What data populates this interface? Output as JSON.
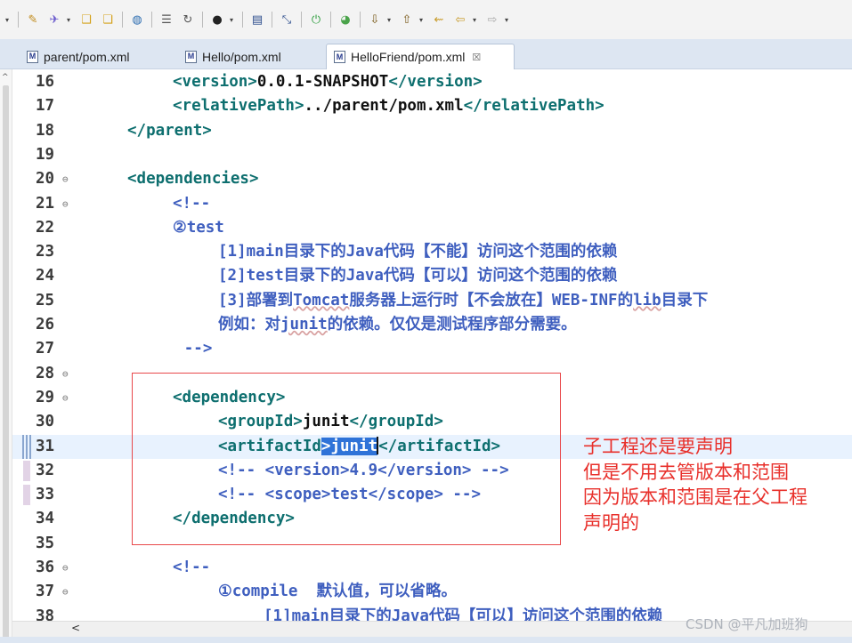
{
  "toolbar": {
    "icons": [
      "wizard-icon",
      "run-icon",
      "folder-icon",
      "folder-open-icon",
      "globe-icon",
      "build-icon",
      "refresh-icon",
      "debug-icon",
      "console-icon",
      "breakpoint-icon",
      "stop-icon",
      "server-icon",
      "down-arrow-icon",
      "up-arrow-icon",
      "back-icon",
      "forward-icon"
    ]
  },
  "tabs": [
    {
      "label": "parent/pom.xml",
      "active": false
    },
    {
      "label": "Hello/pom.xml",
      "active": false
    },
    {
      "label": "HelloFriend/pom.xml",
      "active": true,
      "close": "☒"
    }
  ],
  "editor": {
    "lines": [
      {
        "num": "16",
        "fold": "",
        "indent": "        ",
        "segments": [
          {
            "t": "t",
            "x": "<version>"
          },
          {
            "t": "v",
            "x": "0.0.1-SNAPSHOT"
          },
          {
            "t": "t",
            "x": "</version>"
          }
        ]
      },
      {
        "num": "17",
        "fold": "",
        "indent": "        ",
        "segments": [
          {
            "t": "t",
            "x": "<relativePath>"
          },
          {
            "t": "v",
            "x": "../parent/pom.xml"
          },
          {
            "t": "t",
            "x": "</relativePath>"
          }
        ]
      },
      {
        "num": "18",
        "fold": "",
        "indent": "    ",
        "segments": [
          {
            "t": "t",
            "x": "</parent>"
          }
        ]
      },
      {
        "num": "19",
        "fold": "",
        "indent": "",
        "segments": []
      },
      {
        "num": "20",
        "fold": "⊖",
        "indent": "    ",
        "segments": [
          {
            "t": "t",
            "x": "<dependencies>"
          }
        ]
      },
      {
        "num": "21",
        "fold": "⊖",
        "indent": "        ",
        "segments": [
          {
            "t": "c",
            "x": "<!--"
          }
        ]
      },
      {
        "num": "22",
        "fold": "",
        "indent": "        ",
        "segments": [
          {
            "t": "c",
            "x": "②test"
          }
        ]
      },
      {
        "num": "23",
        "fold": "",
        "indent": "            ",
        "segments": [
          {
            "t": "c",
            "x": "[1]main目录下的Java代码【不能】访问这个范围的依赖"
          }
        ]
      },
      {
        "num": "24",
        "fold": "",
        "indent": "            ",
        "segments": [
          {
            "t": "c",
            "x": "[2]test目录下的Java代码【可以】访问这个范围的依赖"
          }
        ]
      },
      {
        "num": "25",
        "fold": "",
        "indent": "            ",
        "segments": [
          {
            "t": "c",
            "x": "[3]部署到"
          },
          {
            "t": "c sq",
            "x": "Tomcat"
          },
          {
            "t": "c",
            "x": "服务器上运行时【不会放在】WEB-INF的"
          },
          {
            "t": "c sq",
            "x": "lib"
          },
          {
            "t": "c",
            "x": "目录下"
          }
        ]
      },
      {
        "num": "26",
        "fold": "",
        "indent": "            ",
        "segments": [
          {
            "t": "c",
            "x": "例如：对"
          },
          {
            "t": "c sq",
            "x": "junit"
          },
          {
            "t": "c",
            "x": "的依赖。仅仅是测试程序部分需要。"
          }
        ]
      },
      {
        "num": "27",
        "fold": "",
        "indent": "         ",
        "segments": [
          {
            "t": "c",
            "x": "-->"
          }
        ]
      },
      {
        "num": "28",
        "fold": "⊖",
        "indent": "",
        "segments": []
      },
      {
        "num": "29",
        "fold": "⊖",
        "indent": "        ",
        "segments": [
          {
            "t": "t",
            "x": "<dependency>"
          }
        ]
      },
      {
        "num": "30",
        "fold": "",
        "indent": "            ",
        "segments": [
          {
            "t": "t",
            "x": "<groupId>"
          },
          {
            "t": "v",
            "x": "junit"
          },
          {
            "t": "t",
            "x": "</groupId>"
          }
        ]
      },
      {
        "num": "31",
        "fold": "",
        "indent": "            ",
        "current": true,
        "segments": [
          {
            "t": "t",
            "x": "<artifactId"
          },
          {
            "t": "sel",
            "x": ">junit"
          },
          {
            "t": "cursor",
            "x": ""
          },
          {
            "t": "t",
            "x": "</artifactId>"
          }
        ]
      },
      {
        "num": "32",
        "fold": "",
        "indent": "            ",
        "segments": [
          {
            "t": "c",
            "x": "<!-- <version>4.9</version> -->"
          }
        ]
      },
      {
        "num": "33",
        "fold": "",
        "indent": "            ",
        "segments": [
          {
            "t": "c",
            "x": "<!-- <scope>test</scope> -->"
          }
        ]
      },
      {
        "num": "34",
        "fold": "",
        "indent": "        ",
        "segments": [
          {
            "t": "t",
            "x": "</dependency>"
          }
        ]
      },
      {
        "num": "35",
        "fold": "",
        "indent": "",
        "segments": []
      },
      {
        "num": "36",
        "fold": "⊖",
        "indent": "        ",
        "segments": [
          {
            "t": "c",
            "x": "<!--"
          }
        ]
      },
      {
        "num": "37",
        "fold": "⊖",
        "indent": "            ",
        "segments": [
          {
            "t": "c",
            "x": "①compile  默认值，可以省略。"
          }
        ]
      },
      {
        "num": "38",
        "fold": "",
        "indent": "                ",
        "segments": [
          {
            "t": "c",
            "x": "[1]main目录下的Java代码【可以】访问这个范围的依赖"
          }
        ]
      }
    ]
  },
  "annotation": {
    "lines": [
      "子工程还是要声明",
      "但是不用去管版本和范围",
      "因为版本和范围是在父工程",
      "声明的"
    ],
    "color": "#e8302b"
  },
  "hscroll": {
    "left_arrow": "<"
  },
  "watermark": "CSDN @平凡加班狗"
}
